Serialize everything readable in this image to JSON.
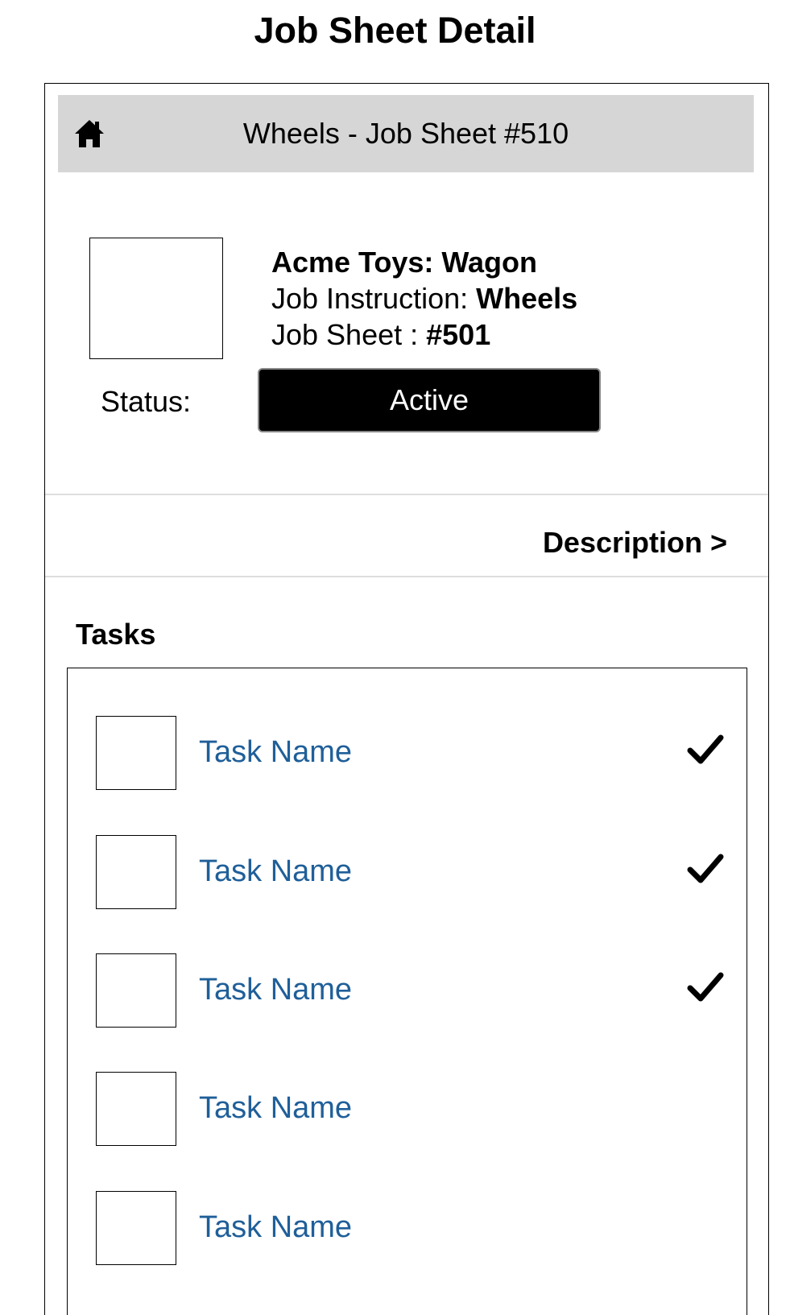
{
  "page_title": "Job Sheet Detail",
  "header": {
    "title": "Wheels - Job Sheet #510",
    "home_icon": "home-icon"
  },
  "summary": {
    "customer_product": "Acme Toys: Wagon",
    "job_instruction_label": "Job Instruction: ",
    "job_instruction_value": "Wheels",
    "job_sheet_label": "Job Sheet : ",
    "job_sheet_value": "#501",
    "status_label": "Status:",
    "status_value": "Active"
  },
  "description_link": "Description >",
  "tasks": {
    "heading": "Tasks",
    "items": [
      {
        "name": "Task Name",
        "completed": true
      },
      {
        "name": "Task Name",
        "completed": true
      },
      {
        "name": "Task Name",
        "completed": true
      },
      {
        "name": "Task Name",
        "completed": false
      },
      {
        "name": "Task Name",
        "completed": false
      }
    ]
  },
  "colors": {
    "header_bg": "#d6d6d6",
    "task_link": "#1f5f99",
    "status_bg": "#000000",
    "status_text": "#ffffff"
  }
}
